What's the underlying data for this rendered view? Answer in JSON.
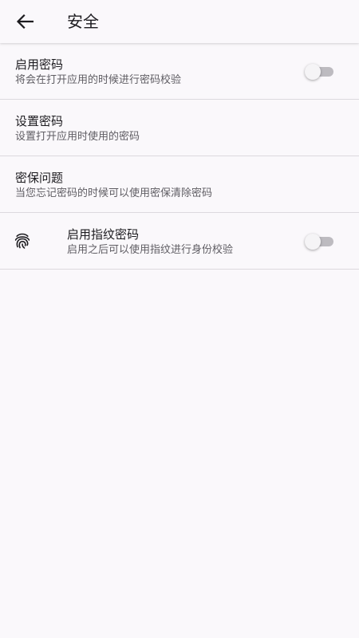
{
  "header": {
    "title": "安全",
    "back_icon": "arrow-left-icon"
  },
  "settings": [
    {
      "title": "启用密码",
      "subtitle": "将会在打开应用的时候进行密码校验",
      "has_switch": true,
      "switch_on": false
    },
    {
      "title": "设置密码",
      "subtitle": "设置打开应用时使用的密码"
    },
    {
      "title": "密保问题",
      "subtitle": "当您忘记密码的时候可以使用密保清除密码"
    },
    {
      "title": "启用指纹密码",
      "subtitle": "启用之后可以使用指纹进行身份校验",
      "icon": "fingerprint-icon",
      "has_switch": true,
      "switch_on": false
    }
  ],
  "colors": {
    "background": "#faf8fb",
    "divider": "#dcd9de",
    "switch_track_off": "#bdbbc0",
    "switch_thumb_off": "#f5f4f6"
  }
}
